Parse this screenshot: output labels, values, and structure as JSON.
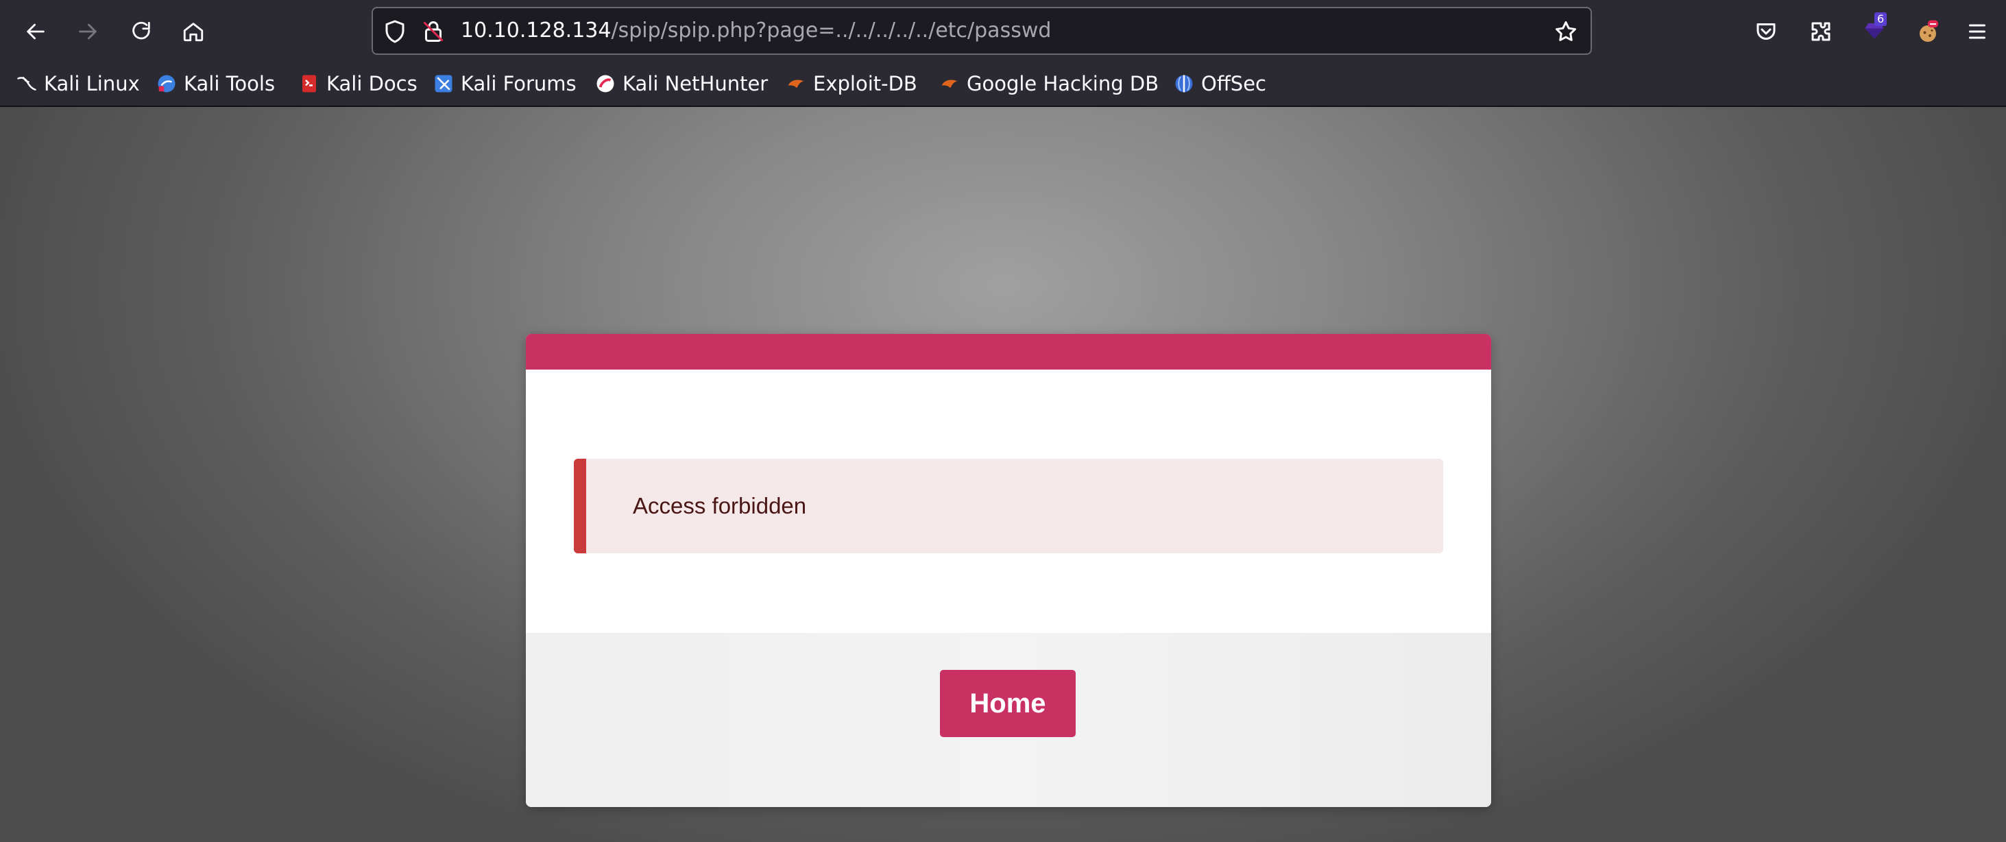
{
  "browser": {
    "url_host": "10.10.128.134",
    "url_path": "/spip/spip.php?page=../../../../../etc/passwd",
    "extension_badge": "6"
  },
  "bookmarks": [
    {
      "label": "Kali Linux",
      "icon": "kali-dragon-icon"
    },
    {
      "label": "Kali Tools",
      "icon": "kali-tools-icon"
    },
    {
      "label": "Kali Docs",
      "icon": "kali-docs-icon"
    },
    {
      "label": "Kali Forums",
      "icon": "kali-forums-icon"
    },
    {
      "label": "Kali NetHunter",
      "icon": "kali-nethunter-icon"
    },
    {
      "label": "Exploit-DB",
      "icon": "exploit-db-icon"
    },
    {
      "label": "Google Hacking DB",
      "icon": "ghdb-icon"
    },
    {
      "label": "OffSec",
      "icon": "offsec-icon"
    }
  ],
  "page": {
    "alert_message": "Access forbidden",
    "home_button": "Home"
  },
  "colors": {
    "accent": "#c93163",
    "alert_bg": "#f5e8e8",
    "alert_border": "#c93a3a"
  }
}
